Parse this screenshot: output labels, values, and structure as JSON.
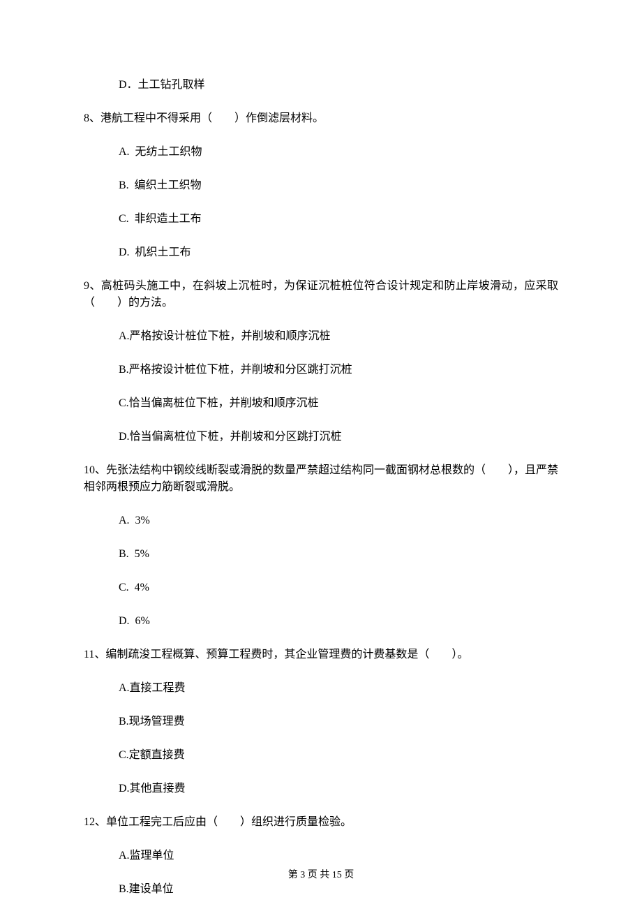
{
  "q7_trailing_option": "D．土工钻孔取样",
  "q8": {
    "stem": "8、港航工程中不得采用（　　）作倒滤层材料。",
    "opts": [
      "A.  无纺土工织物",
      "B.  编织土工织物",
      "C.  非织造土工布",
      "D.  机织土工布"
    ]
  },
  "q9": {
    "stem": "9、高桩码头施工中，在斜坡上沉桩时，为保证沉桩桩位符合设计规定和防止岸坡滑动，应采取（　　）的方法。",
    "opts": [
      "A.严格按设计桩位下桩，并削坡和顺序沉桩",
      "B.严格按设计桩位下桩，并削坡和分区跳打沉桩",
      "C.恰当偏离桩位下桩，并削坡和顺序沉桩",
      "D.恰当偏离桩位下桩，并削坡和分区跳打沉桩"
    ]
  },
  "q10": {
    "stem": "10、先张法结构中钢绞线断裂或滑脱的数量严禁超过结构同一截面钢材总根数的（　　），且严禁相邻两根预应力筋断裂或滑脱。",
    "opts": [
      "A.  3%",
      "B.  5%",
      "C.  4%",
      "D.  6%"
    ]
  },
  "q11": {
    "stem": "11、编制疏浚工程概算、预算工程费时，其企业管理费的计费基数是（　　）。",
    "opts": [
      "A.直接工程费",
      "B.现场管理费",
      "C.定额直接费",
      "D.其他直接费"
    ]
  },
  "q12": {
    "stem": "12、单位工程完工后应由（　　）组织进行质量检验。",
    "opts": [
      "A.监理单位",
      "B.建设单位"
    ]
  },
  "footer": "第 3 页 共 15 页"
}
